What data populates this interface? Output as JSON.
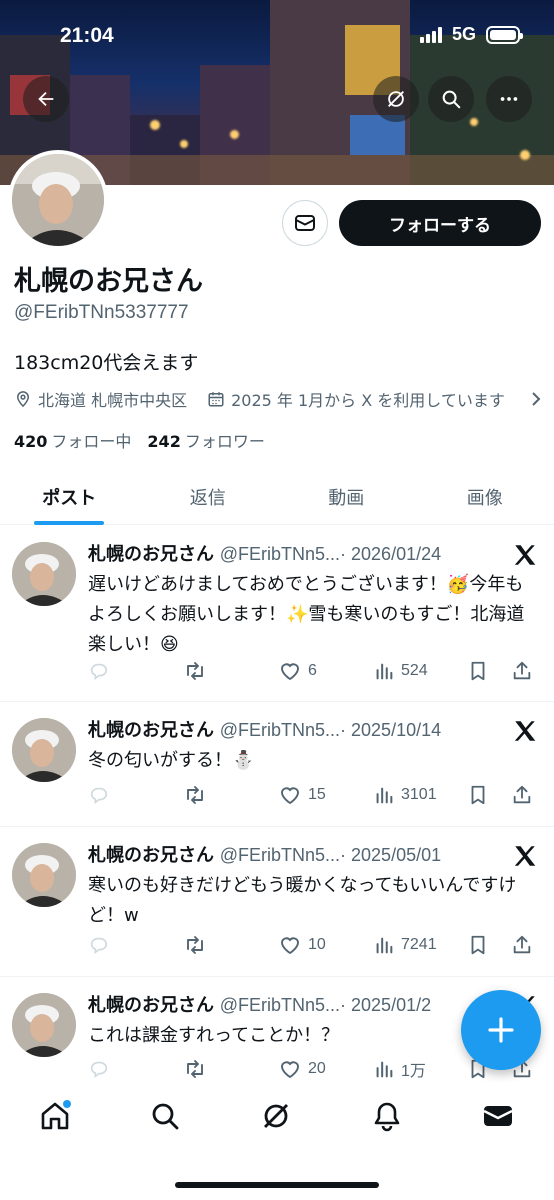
{
  "status_bar": {
    "time": "21:04",
    "network": "5G"
  },
  "profile": {
    "display_name": "札幌のお兄さん",
    "handle": "@FEribTNn5337777",
    "bio": "183cm20代会えます",
    "location": "北海道 札幌市中央区",
    "joined": "2025 年 1月から X を利用しています",
    "following_count": "420",
    "following_label": "フォロー中",
    "followers_count": "242",
    "followers_label": "フォロワー",
    "follow_button": "フォローする"
  },
  "tabs": [
    {
      "label": "ポスト",
      "active": true
    },
    {
      "label": "返信",
      "active": false
    },
    {
      "label": "動画",
      "active": false
    },
    {
      "label": "画像",
      "active": false
    }
  ],
  "posts": [
    {
      "name": "札幌のお兄さん",
      "handle": "@FEribTNn5...",
      "date": "· 2026/01/24",
      "text": "遅いけどあけましておめでとうございます！🥳今年もよろしくお願いします！✨雪も寒いのもすご！北海道楽しい！😆",
      "likes": "6",
      "views": "524"
    },
    {
      "name": "札幌のお兄さん",
      "handle": "@FEribTNn5...",
      "date": "· 2025/10/14",
      "text": "冬の匂いがする！⛄",
      "likes": "15",
      "views": "3101"
    },
    {
      "name": "札幌のお兄さん",
      "handle": "@FEribTNn5...",
      "date": "· 2025/05/01",
      "text": "寒いのも好きだけどもう暖かくなってもいいんですけど！w",
      "likes": "10",
      "views": "7241"
    },
    {
      "name": "札幌のお兄さん",
      "handle": "@FEribTNn5...",
      "date": "· 2025/01/2",
      "text": "これは課金すれってことか！？",
      "likes": "20",
      "views": "1万"
    }
  ],
  "colors": {
    "accent": "#1d9bf0",
    "text": "#0f1419",
    "secondary": "#536471",
    "follow_button_bg": "#0f1419"
  },
  "icons": [
    "back-arrow-icon",
    "grok-icon",
    "search-icon",
    "more-icon",
    "message-icon",
    "location-icon",
    "calendar-icon",
    "chevron-right-icon",
    "x-logo-icon",
    "reply-icon",
    "retweet-icon",
    "heart-icon",
    "views-icon",
    "bookmark-icon",
    "share-icon",
    "compose-plus-icon",
    "home-icon",
    "notifications-icon",
    "mail-icon"
  ]
}
